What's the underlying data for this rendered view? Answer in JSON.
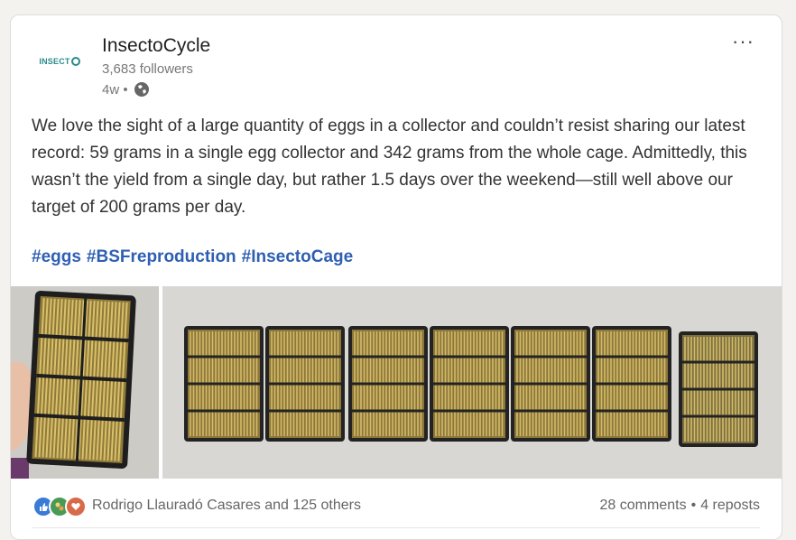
{
  "post": {
    "company_name": "InsectoCycle",
    "logo_text": "INSECT",
    "followers": "3,683 followers",
    "time_label": "4w •",
    "more_label": "···",
    "text": "We love the sight of a large quantity of eggs in a collector and couldn’t resist sharing our latest record: 59 grams in a single egg collector and 342 grams from the whole cage. Admittedly, this wasn’t the yield from a single day, but rather 1.5 days over the weekend—still well above our target of 200 grams per day.",
    "hashtags": [
      "#eggs",
      "#BSFreproduction",
      "#InsectoCage"
    ]
  },
  "social": {
    "reactors": "Rodrigo Llauradó Casares and 125 others",
    "comments": "28 comments",
    "separator": "•",
    "reposts": "4 reposts"
  },
  "icons": [
    "globe-icon",
    "like-icon",
    "celebrate-icon",
    "love-icon"
  ],
  "colors": {
    "hashtag": "#2f5fb3",
    "logo": "#2b8a8a",
    "egg_gold": "#b89a45"
  }
}
